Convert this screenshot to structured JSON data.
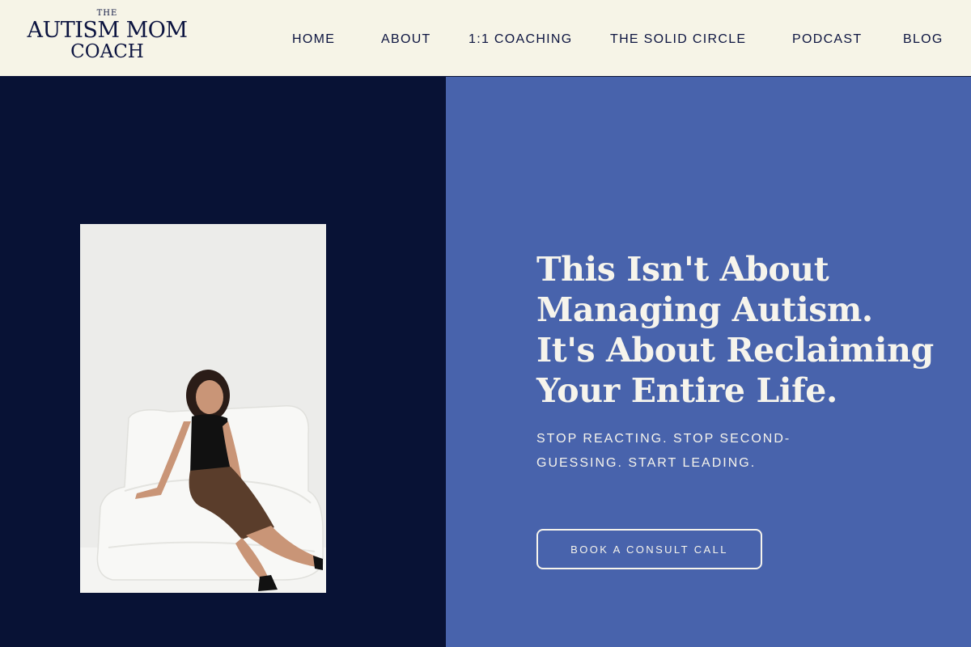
{
  "logo": {
    "the": "THE",
    "main": "AUTISM MOM",
    "sub": "COACH"
  },
  "nav": {
    "items": [
      {
        "label": "HOME"
      },
      {
        "label": "ABOUT"
      },
      {
        "label": "1:1 COACHING"
      },
      {
        "label": "THE SOLID CIRCLE"
      },
      {
        "label": "PODCAST"
      },
      {
        "label": "BLOG"
      }
    ]
  },
  "hero": {
    "headline_lines": [
      "This Isn't About",
      "Managing Autism.",
      "It's About Reclaiming",
      "Your Entire Life."
    ],
    "subheadline": "STOP REACTING. STOP SECOND-GUESSING. START LEADING.",
    "cta_label": "BOOK A CONSULT CALL"
  },
  "colors": {
    "header_bg": "#f6f4e7",
    "navy": "#081235",
    "blue": "#4863ac",
    "cream_text": "#f6f4ec"
  }
}
